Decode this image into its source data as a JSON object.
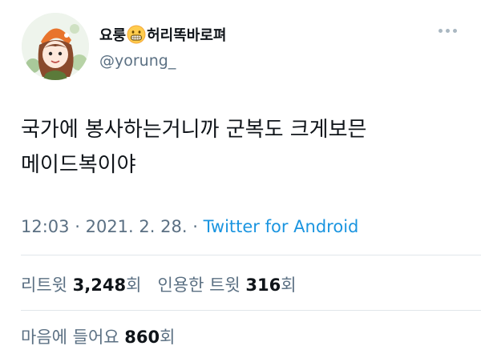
{
  "profile": {
    "name_prefix": "요룽",
    "name_suffix": "허리똑바로펴",
    "handle": "@yorung_",
    "emoji": "grimacing-face-icon"
  },
  "tweet": {
    "text": "국가에 봉사하는거니까 군복도 크게보믄\n메이드복이야",
    "time": "12:03",
    "sep1": "·",
    "date": "2021. 2. 28.",
    "sep2": "·",
    "source": "Twitter for Android"
  },
  "stats": {
    "retweet_label": "리트윗",
    "retweet_count": "3,248",
    "retweet_unit": "회",
    "quote_label": "인용한 트윗",
    "quote_count": "316",
    "quote_unit": "회",
    "like_label": "마음에 들어요",
    "like_count": "860",
    "like_unit": "회"
  },
  "colors": {
    "text": "#0f1419",
    "muted": "#5b7083",
    "link": "#1b95e0",
    "divider": "#e1e6ea"
  }
}
